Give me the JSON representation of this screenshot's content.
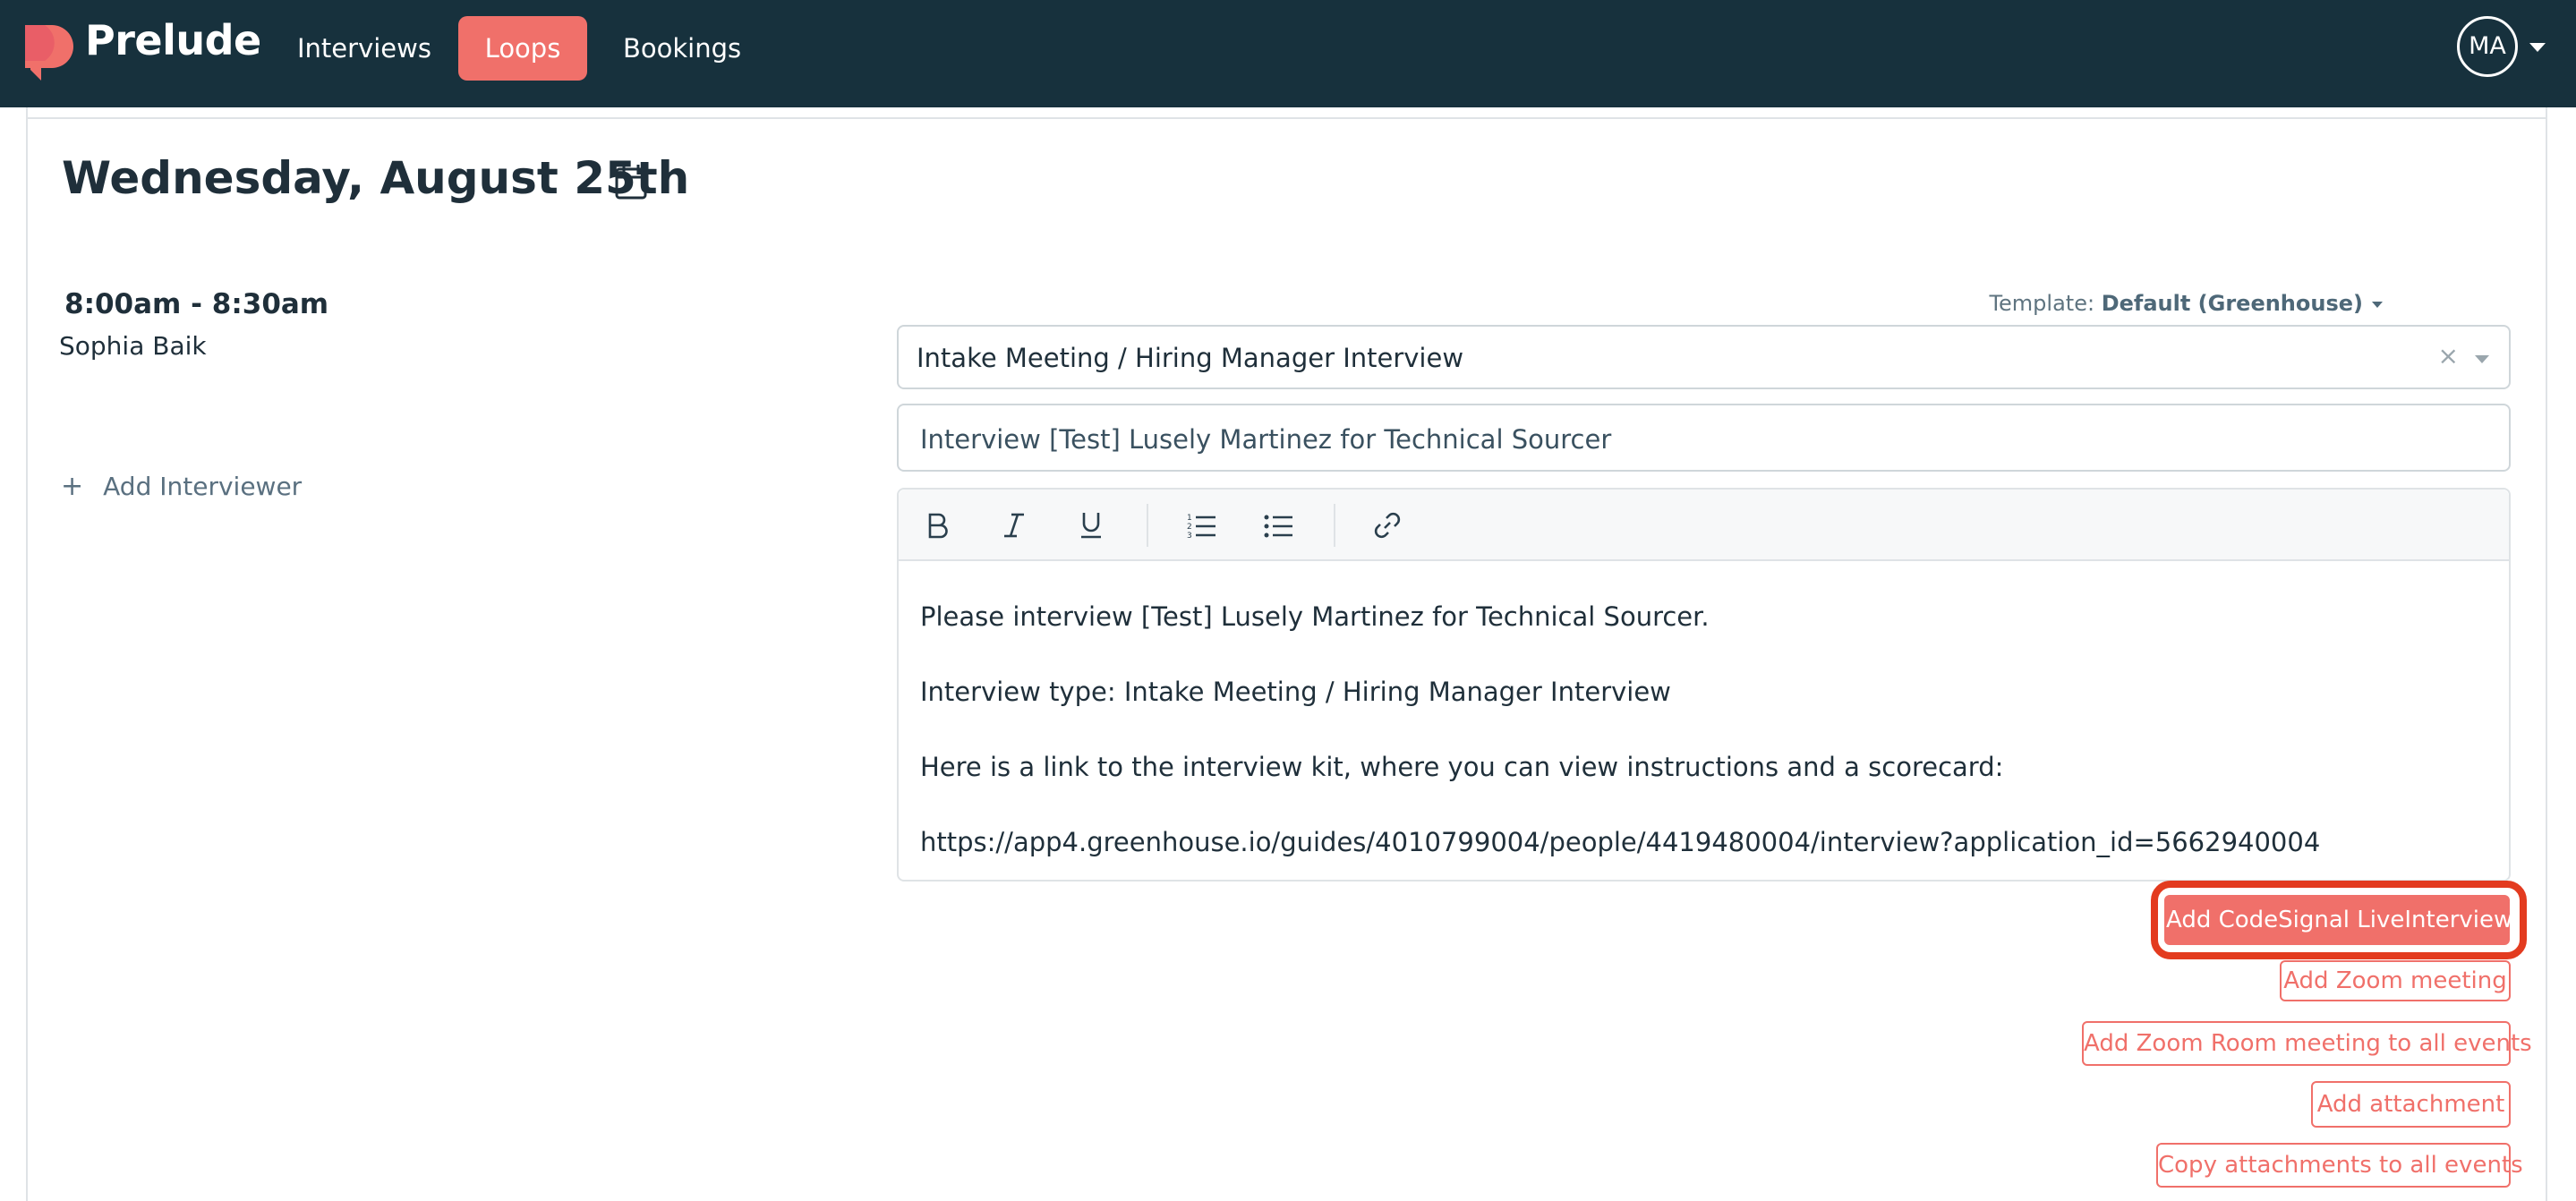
{
  "app": {
    "brand": "Prelude"
  },
  "nav": {
    "items": [
      {
        "label": "Interviews"
      },
      {
        "label": "Loops",
        "active": true
      },
      {
        "label": "Bookings"
      }
    ],
    "avatar_initials": "MA",
    "accent_color": "#f0706a",
    "bar_color": "#17313d"
  },
  "loop": {
    "day_title": "Wednesday, August 25th",
    "slot": {
      "time": "8:00am - 8:30am",
      "interviewer": "Sophia Baik",
      "add_interviewer_label": "Add Interviewer"
    },
    "template": {
      "prefix": "Template: ",
      "value": "Default (Greenhouse)"
    },
    "interview_select": {
      "value": "Intake Meeting / Hiring Manager Interview",
      "clear_glyph": "×"
    },
    "subject": {
      "value": "Interview [Test] Lusely Martinez for Technical Sourcer"
    },
    "editor": {
      "toolbar": [
        "bold-icon",
        "italic-icon",
        "underline-icon",
        "ordered-list-icon",
        "bullet-list-icon",
        "link-icon"
      ],
      "lines": [
        "Please interview [Test] Lusely Martinez for Technical Sourcer.",
        "Interview type: Intake Meeting / Hiring Manager Interview",
        "Here is a link to the interview kit, where you can view instructions and a scorecard:",
        "https://app4.greenhouse.io/guides/4010799004/people/4419480004/interview?application_id=5662940004"
      ]
    },
    "actions": {
      "codesignal": "Add CodeSignal LiveInterview",
      "zoom": "Add Zoom meeting",
      "zoom_room": "Add Zoom Room meeting to all events",
      "attachment": "Add attachment",
      "copy_attachments": "Copy attachments to all events"
    }
  }
}
